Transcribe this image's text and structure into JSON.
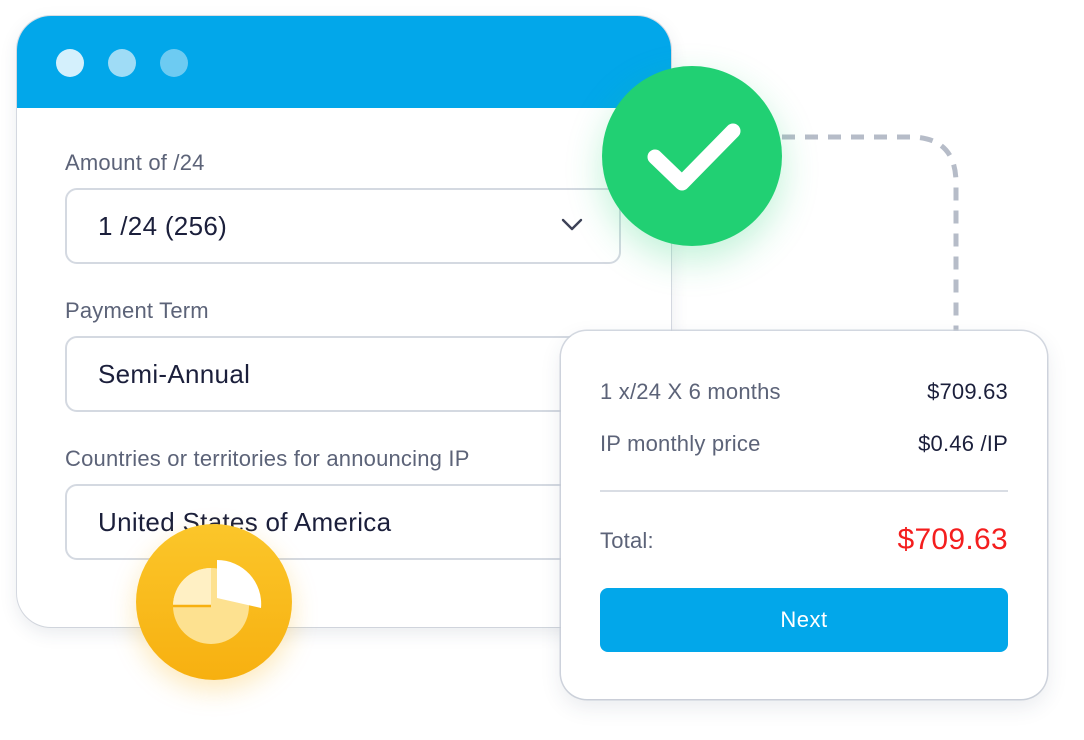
{
  "form": {
    "amount": {
      "label": "Amount of /24",
      "value": "1 /24 (256)"
    },
    "payment_term": {
      "label": "Payment Term",
      "value": "Semi-Annual"
    },
    "countries": {
      "label": "Countries or territories for announcing IP",
      "value": "United States of America"
    }
  },
  "summary": {
    "line1": {
      "label": "1 x/24 X 6 months",
      "value": "$709.63"
    },
    "line2": {
      "label": "IP monthly price",
      "value": "$0.46 /IP"
    },
    "total": {
      "label": "Total:",
      "value": "$709.63"
    },
    "next_label": "Next"
  },
  "colors": {
    "accent": "#02a7ea",
    "success": "#21d073",
    "total_red": "#f41e1e",
    "badge_yellow": "#f7b010"
  },
  "icons": {
    "badge_check": "check-icon",
    "badge_pie": "pie-chart-icon",
    "dropdown": "chevron-down-icon"
  }
}
